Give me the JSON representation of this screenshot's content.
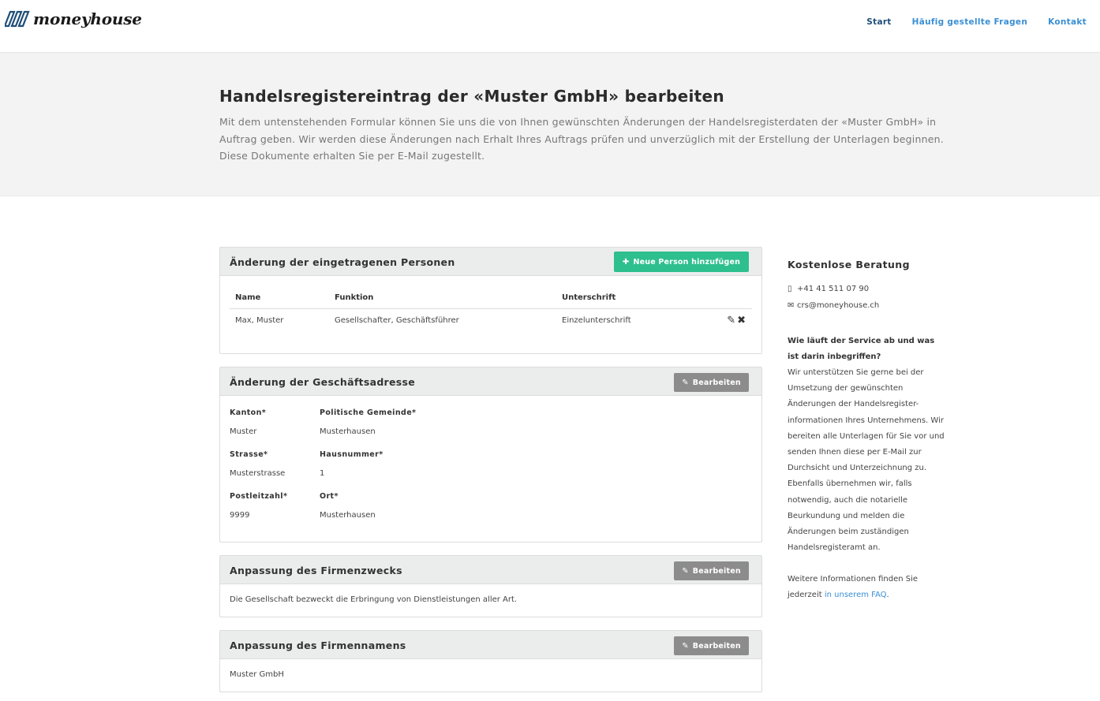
{
  "header": {
    "logo_text": "moneyhouse",
    "nav": [
      {
        "label": "Start"
      },
      {
        "label": "Häufig gestellte Fragen"
      },
      {
        "label": "Kontakt"
      }
    ]
  },
  "hero": {
    "title": "Handelsregistereintrag der «Muster GmbH» bearbeiten",
    "description": "Mit dem untenstehenden Formular können Sie uns die von Ihnen gewünschten Änderungen der Handelsregisterdaten der «Muster GmbH» in Auftrag geben. Wir werden diese Änderungen nach Erhalt Ihres Auftrags prüfen und unverzüglich mit der Erstellung der Unterlagen beginnen. Diese Dokumente erhalten Sie per E-Mail zugestellt."
  },
  "persons": {
    "title": "Änderung der eingetragenen Personen",
    "add_button": "Neue Person hinzufügen",
    "columns": [
      "Name",
      "Funktion",
      "Unterschrift"
    ],
    "rows": [
      {
        "name": "Max, Muster",
        "function": "Gesellschafter, Geschäftsführer",
        "signature": "Einzelunterschrift"
      }
    ]
  },
  "address": {
    "title": "Änderung der Geschäftsadresse",
    "edit_button": "Bearbeiten",
    "fields": [
      {
        "label": "Kanton*",
        "value": "Muster"
      },
      {
        "label": "Politische Gemeinde*",
        "value": "Musterhausen"
      },
      {
        "label": "Strasse*",
        "value": "Musterstrasse"
      },
      {
        "label": "Hausnummer*",
        "value": "1"
      },
      {
        "label": "Postleitzahl*",
        "value": "9999"
      },
      {
        "label": "Ort*",
        "value": "Musterhausen"
      }
    ]
  },
  "purpose": {
    "title": "Anpassung des Firmenzwecks",
    "edit_button": "Bearbeiten",
    "text": "Die Gesellschaft bezweckt die Erbringung von Dienstleistungen aller Art."
  },
  "company_name": {
    "title": "Anpassung des Firmennamens",
    "edit_button": "Bearbeiten",
    "text": "Muster GmbH"
  },
  "sidebar": {
    "title": "Kostenlose Beratung",
    "phone": "+41 41 511 07 90",
    "email": "crs@moneyhouse.ch",
    "question": "Wie läuft der Service ab und was ist darin inbegriffen?",
    "answer": "Wir unterstützen Sie gerne bei der Umsetzung der gewünschten Änderungen der Handelsregister-informationen Ihres Unternehmens. Wir bereiten alle Unterlagen für Sie vor und senden Ihnen diese per E-Mail zur Durchsicht und Unterzeichnung zu. Ebenfalls übernehmen wir, falls notwendig, auch die notarielle Beurkundung und melden die Änderungen beim zuständigen Handelsregisteramt an.",
    "more_prefix": "Weitere Informationen finden Sie jederzeit",
    "more_link": "in unserem FAQ",
    "more_suffix": "."
  },
  "colors": {
    "accent_link": "#3b8fd4",
    "nav_active": "#1f4e79",
    "add_button": "#2ebf8e",
    "edit_button": "#8c8c8c",
    "logo_blue": "#1f4e79"
  }
}
